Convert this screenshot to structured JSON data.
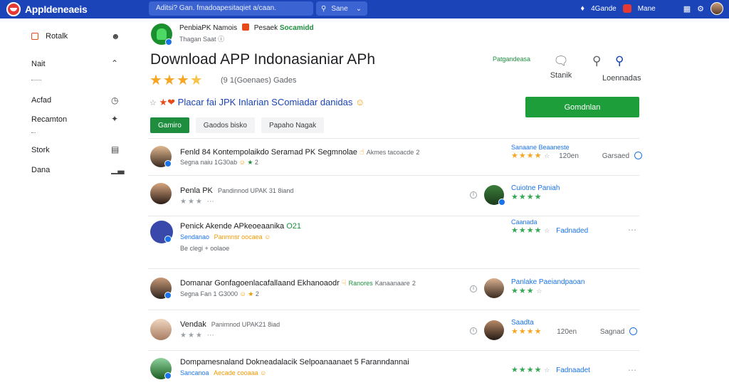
{
  "topbar": {
    "logo_text": "AppIdeneaeis",
    "search_placeholder": "Aditsi? Gan. fmadoapesitaqiet a/caan.",
    "search_button": "Sane",
    "account_label": "4Gande",
    "user_label": "Mane"
  },
  "sidebar": {
    "items": [
      {
        "label": "Rotalk",
        "icon": "user-icon"
      },
      {
        "label": "Nait",
        "icon": "chevron-up-icon"
      },
      {
        "label": "Acfad",
        "icon": "clock-icon"
      },
      {
        "label": "Recamton",
        "icon": "sparkle-icon"
      },
      {
        "label": "Stork",
        "icon": "list-icon"
      },
      {
        "label": "Dana",
        "icon": "chart-icon"
      }
    ]
  },
  "app": {
    "developer": "PenbiaPK Namois",
    "developer_tag": "Pesaek",
    "developer_badge": "Socamidd",
    "developer_sub": "Thagan Saat",
    "title": "Download APP Indonasianiar APh",
    "rating_text": "(9 1(Goenaes) Gades",
    "promo_text": "Placar fai JPK Inlarian SComiadar danidas",
    "meta_link": "Patgandeasa",
    "actions": [
      {
        "label": "Stanik",
        "icon": "comment-icon"
      },
      {
        "label": "Loennadas",
        "icon": "search-icon"
      }
    ],
    "download_button": "Gomdnlan",
    "tabs": [
      "Gamiro",
      "Gaodos bisko",
      "Papaho Nagak"
    ]
  },
  "reviews": [
    {
      "title": "Fenld 84 Kontempolaikdo Seramad PK Segmnolae",
      "title_tag": "Akmes tacoacde",
      "title_count": "2",
      "sub": "Segna naiu 1G30ab",
      "sub_tail": "2",
      "right_label": "Sanaane Beaaneste",
      "right_count": "120en",
      "right_action": "Garsaed"
    },
    {
      "title": "Penla PK",
      "title_tail": "Pandinnod UPAK 31 8iand",
      "sub": "",
      "right_name": "Cuiotne Paniah"
    },
    {
      "title": "Penick Akende APkeoeaanika",
      "title_tag": "O21",
      "sub": "Sendanao",
      "sub_tail": "Panmnsr oocaea",
      "sub2": "Be clegi + oolaoe",
      "right_label": "Caanada",
      "right_action": "Fadnaded"
    },
    {
      "title": "Domanar Gonfagoenlacafallaand Ekhanoaodr",
      "title_tag": "Ranores",
      "title_tail": "Kanaanaare",
      "title_count": "2",
      "sub": "Segna Fan 1 G3000",
      "sub_tail": "2",
      "right_name": "Panlake Paeiandpaoan"
    },
    {
      "title": "Vendak",
      "title_tail": "Panimnod UPAK21 8iad",
      "right_name": "Saadta",
      "right_count": "120en",
      "right_action": "Sagnad"
    },
    {
      "title": "Dompamesnaland Dokneadalacik Selpoanaanaet 5 Faranndannai",
      "sub": "Sancanoa",
      "sub_tail": "Aecade cooaaa",
      "right_action": "Fadnaadet"
    }
  ],
  "colors": {
    "topbar": "#1a44b8",
    "accent_green": "#1e9e3a",
    "star": "#f6a623",
    "link_blue": "#1a73e8"
  }
}
